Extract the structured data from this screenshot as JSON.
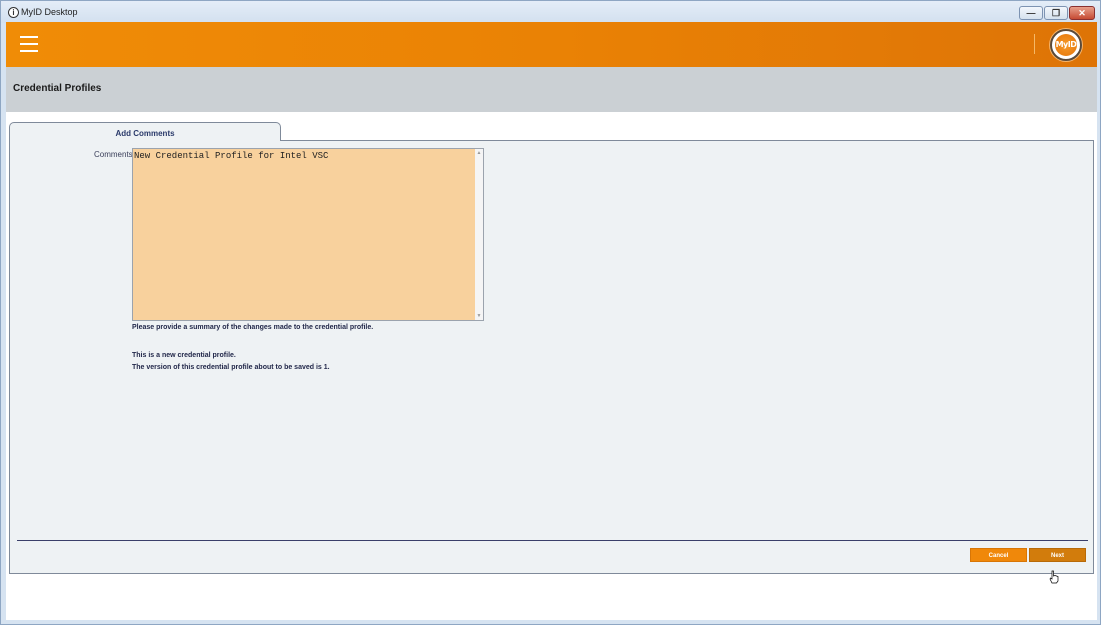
{
  "window": {
    "title": "MyID Desktop",
    "controls": {
      "minimize": "minimize",
      "restore": "restore",
      "close": "close"
    }
  },
  "header": {
    "menu_icon": "hamburger-menu-icon",
    "logo_text": "MyID"
  },
  "page": {
    "title": "Credential Profiles"
  },
  "tabs": [
    {
      "label": "Add Comments",
      "active": true
    }
  ],
  "form": {
    "comments_label": "Comments:",
    "comments_value": "New Credential Profile for Intel VSC",
    "help_summary": "Please provide a summary of the changes made to the credential profile.",
    "info_new": "This is a new credential profile.",
    "info_version": "The version of this credential profile about to be saved is 1."
  },
  "buttons": {
    "cancel": "Cancel",
    "next": "Next"
  },
  "colors": {
    "header_orange": "#ea8205",
    "comments_bg": "#f8d19d",
    "button_orange": "#f0880a",
    "page_header_gray": "#cbd0d4"
  }
}
